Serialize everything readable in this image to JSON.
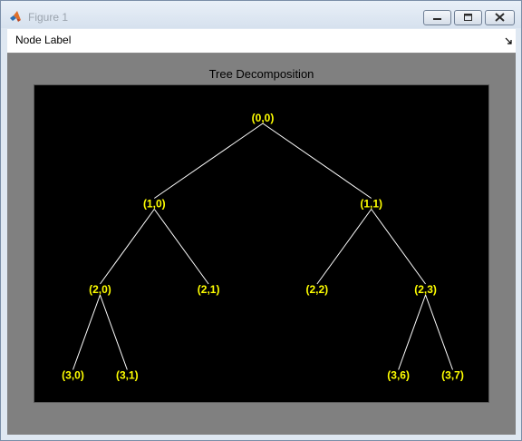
{
  "window": {
    "title": "Figure 1",
    "controls": [
      "minimize",
      "maximize",
      "close"
    ]
  },
  "toolbar": {
    "menu_label": "Node Label",
    "corner_icon": "dock-arrow-icon"
  },
  "axes": {
    "title": "Tree Decomposition"
  },
  "tree": {
    "node_color": "#ffff00",
    "edge_color": "#ffffff",
    "background": "#000000",
    "nodes": [
      {
        "id": "0-0",
        "label": "(0,0)",
        "depth": 0,
        "index": 0
      },
      {
        "id": "1-0",
        "label": "(1,0)",
        "depth": 1,
        "index": 0,
        "parent": "0-0"
      },
      {
        "id": "1-1",
        "label": "(1,1)",
        "depth": 1,
        "index": 1,
        "parent": "0-0"
      },
      {
        "id": "2-0",
        "label": "(2,0)",
        "depth": 2,
        "index": 0,
        "parent": "1-0"
      },
      {
        "id": "2-1",
        "label": "(2,1)",
        "depth": 2,
        "index": 1,
        "parent": "1-0"
      },
      {
        "id": "2-2",
        "label": "(2,2)",
        "depth": 2,
        "index": 2,
        "parent": "1-1"
      },
      {
        "id": "2-3",
        "label": "(2,3)",
        "depth": 2,
        "index": 3,
        "parent": "1-1"
      },
      {
        "id": "3-0",
        "label": "(3,0)",
        "depth": 3,
        "index": 0,
        "parent": "2-0"
      },
      {
        "id": "3-1",
        "label": "(3,1)",
        "depth": 3,
        "index": 1,
        "parent": "2-0"
      },
      {
        "id": "3-6",
        "label": "(3,6)",
        "depth": 3,
        "index": 6,
        "parent": "2-3"
      },
      {
        "id": "3-7",
        "label": "(3,7)",
        "depth": 3,
        "index": 7,
        "parent": "2-3"
      }
    ]
  }
}
